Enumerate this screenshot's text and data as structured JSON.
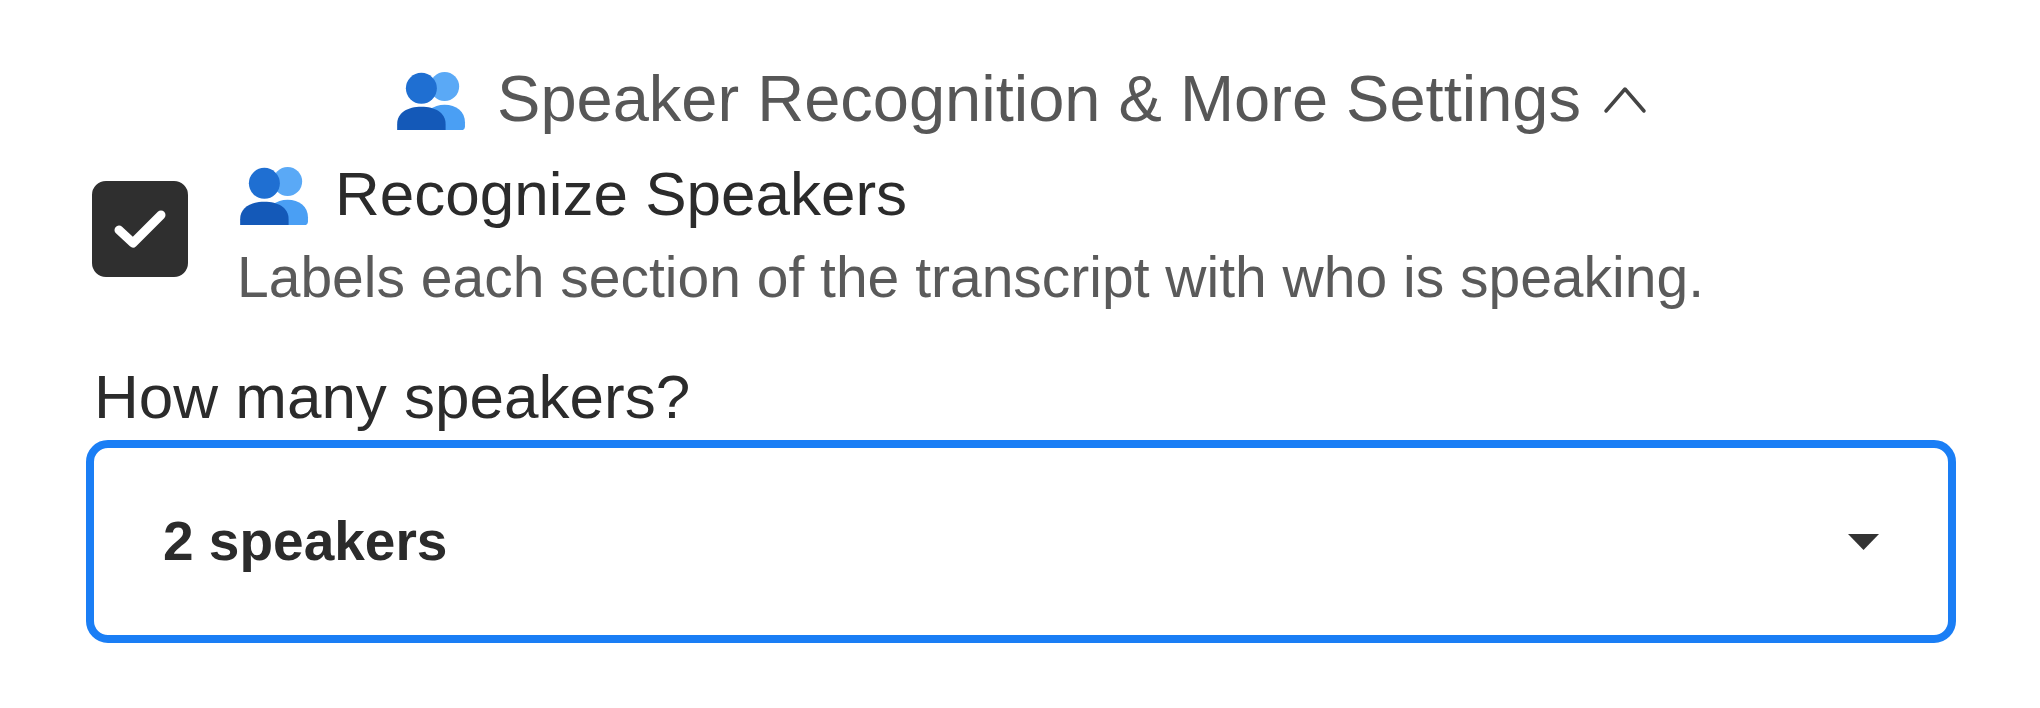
{
  "section": {
    "title": "Speaker Recognition & More Settings",
    "expanded": true
  },
  "recognize_speakers": {
    "label": "Recognize Speakers",
    "description": "Labels each section of the transcript with who is speaking.",
    "checked": true
  },
  "speaker_count": {
    "label": "How many speakers?",
    "value": "2 speakers",
    "focused": true
  }
}
